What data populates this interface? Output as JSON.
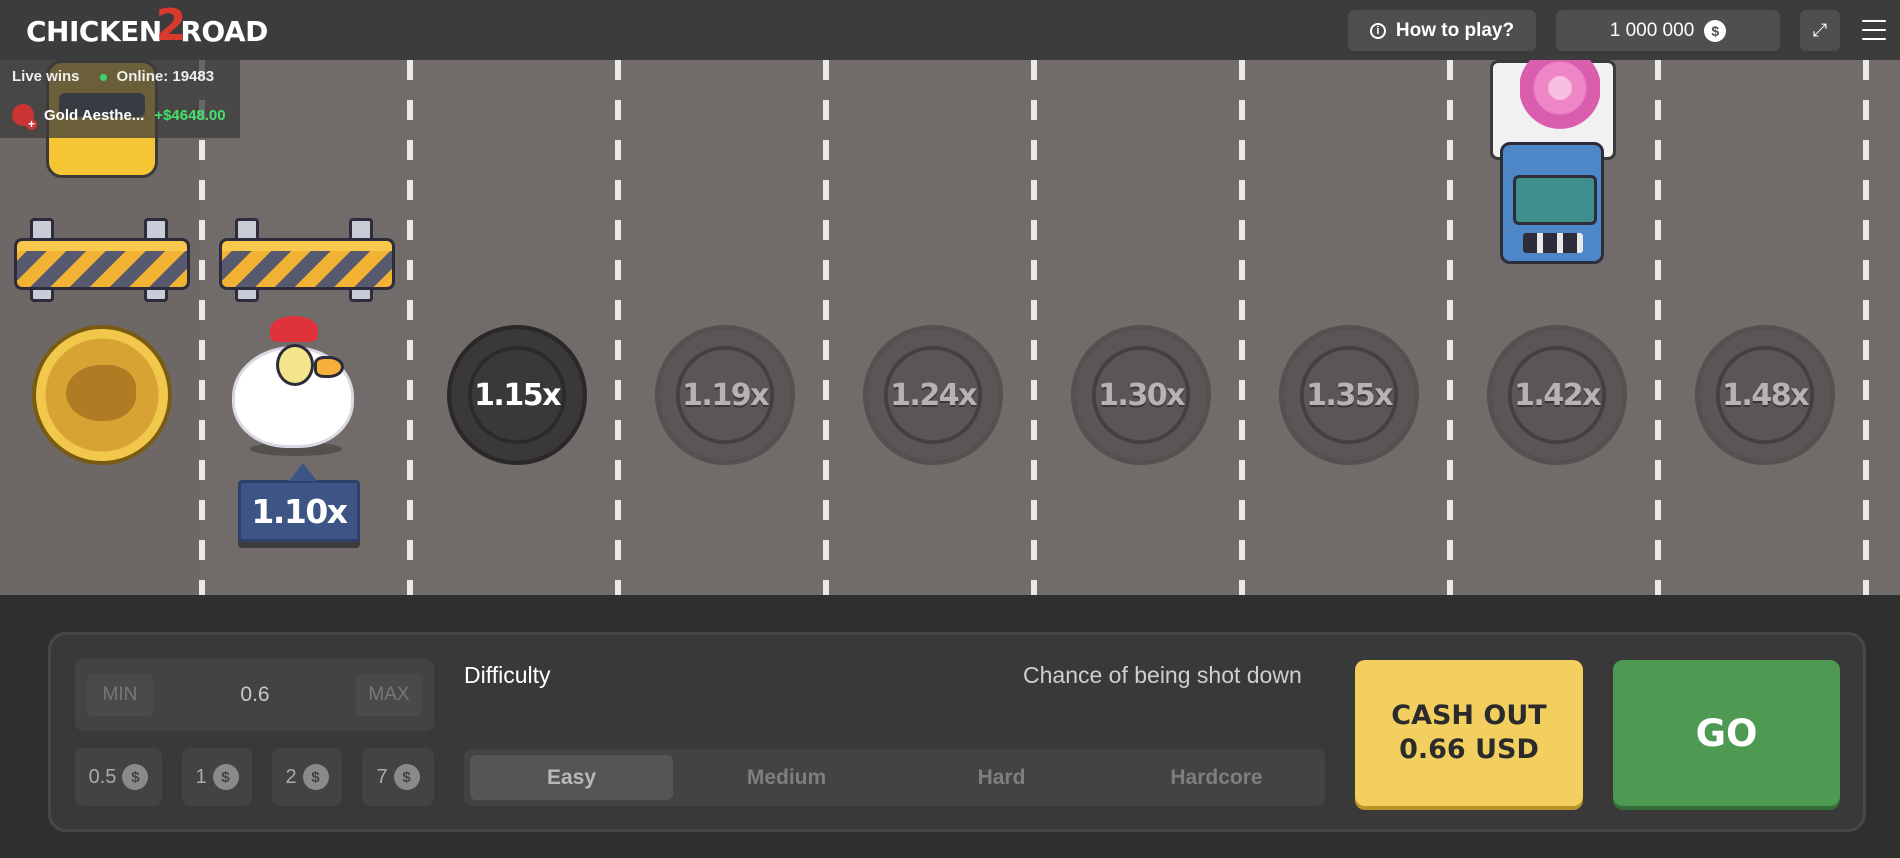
{
  "header": {
    "logo_left": "CHICKEN",
    "logo_num": "2",
    "logo_right": "ROAD",
    "how_to_play": "How to play?",
    "balance": "1 000 000",
    "currency_symbol": "$"
  },
  "live": {
    "label": "Live wins",
    "online": "Online: 19483",
    "winner_name": "Gold Aesthe...",
    "winner_amount": "+$4648.00"
  },
  "game": {
    "current_multiplier": "1.10x",
    "lanes": [
      "1.15x",
      "1.19x",
      "1.24x",
      "1.30x",
      "1.35x",
      "1.42x",
      "1.48x"
    ]
  },
  "bet": {
    "min_label": "MIN",
    "max_label": "MAX",
    "value": "0.6",
    "chips": [
      "0.5",
      "1",
      "2",
      "7"
    ],
    "chip_symbol": "$"
  },
  "difficulty": {
    "label": "Difficulty",
    "chance_label": "Chance of being shot down",
    "options": [
      "Easy",
      "Medium",
      "Hard",
      "Hardcore"
    ],
    "selected": "Easy"
  },
  "actions": {
    "cashout_line1": "CASH OUT",
    "cashout_line2": "0.66 USD",
    "go": "GO"
  },
  "colors": {
    "accent_yellow": "#f2cf5e",
    "go_green": "#4f9a52",
    "win_green": "#42e36b",
    "multiplier_blue": "#3c5584"
  }
}
